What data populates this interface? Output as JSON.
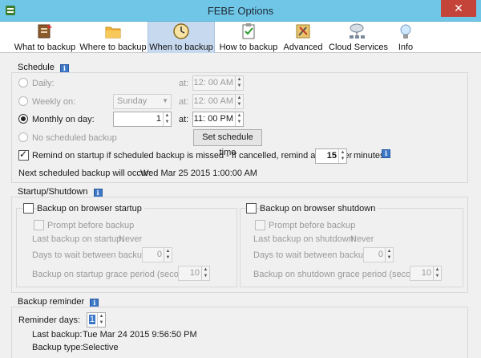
{
  "window": {
    "title": "FEBE Options",
    "close_glyph": "✕"
  },
  "toolbar": {
    "items": [
      {
        "label": "What to backup",
        "icon": "what-to-backup-icon"
      },
      {
        "label": "Where to backup",
        "icon": "folder-icon"
      },
      {
        "label": "When to backup",
        "icon": "clock-icon",
        "active": true
      },
      {
        "label": "How to backup",
        "icon": "clipboard-icon"
      },
      {
        "label": "Advanced",
        "icon": "advanced-tools-icon"
      },
      {
        "label": "Cloud Services",
        "icon": "cloud-network-icon"
      },
      {
        "label": "Info",
        "icon": "lightbulb-icon"
      }
    ]
  },
  "schedule": {
    "title": "Schedule",
    "daily_label": "Daily:",
    "weekly_label": "Weekly on:",
    "weekly_day": "Sunday",
    "monthly_label": "Monthly on day:",
    "monthly_day": "1",
    "no_schedule_label": "No scheduled backup",
    "at_label": "at:",
    "daily_time": "12: 00 AM",
    "weekly_time": "12: 00 AM",
    "monthly_time": "11: 00 PM",
    "set_time_button": "Set schedule time",
    "remind_label": "Remind on startup if scheduled backup is missed - If cancelled, remind again after",
    "remind_minutes": "15",
    "minutes_label": "minutes",
    "next_label": "Next scheduled backup will occur:",
    "next_value": "Wed Mar 25 2015 1:00:00 AM",
    "selected": "monthly",
    "remind_checked": true
  },
  "startup_shutdown": {
    "title": "Startup/Shutdown",
    "startup": {
      "title": "Backup on browser startup",
      "prompt_label": "Prompt before backup",
      "last_label": "Last backup on startup:",
      "last_value": "Never",
      "days_label": "Days to wait between backups:",
      "days_value": "0",
      "grace_label": "Backup on startup grace period (seconds)",
      "grace_value": "10"
    },
    "shutdown": {
      "title": "Backup on browser shutdown",
      "prompt_label": "Prompt before backup",
      "last_label": "Last backup on shutdown:",
      "last_value": "Never",
      "days_label": "Days to wait between backups:",
      "days_value": "0",
      "grace_label": "Backup on shutdown grace period (seconds)",
      "grace_value": "10"
    }
  },
  "reminder": {
    "title": "Backup reminder",
    "days_label": "Reminder days:",
    "days_value": "1",
    "last_label": "Last backup:",
    "last_value": "Tue Mar 24 2015 9:56:50 PM",
    "type_label": "Backup type:",
    "type_value": "Selective"
  },
  "colors": {
    "titlebar": "#6fc6e7",
    "close_button": "#c4443a",
    "active_tab": "#c7d9ef",
    "info_icon": "#3d78c6"
  }
}
